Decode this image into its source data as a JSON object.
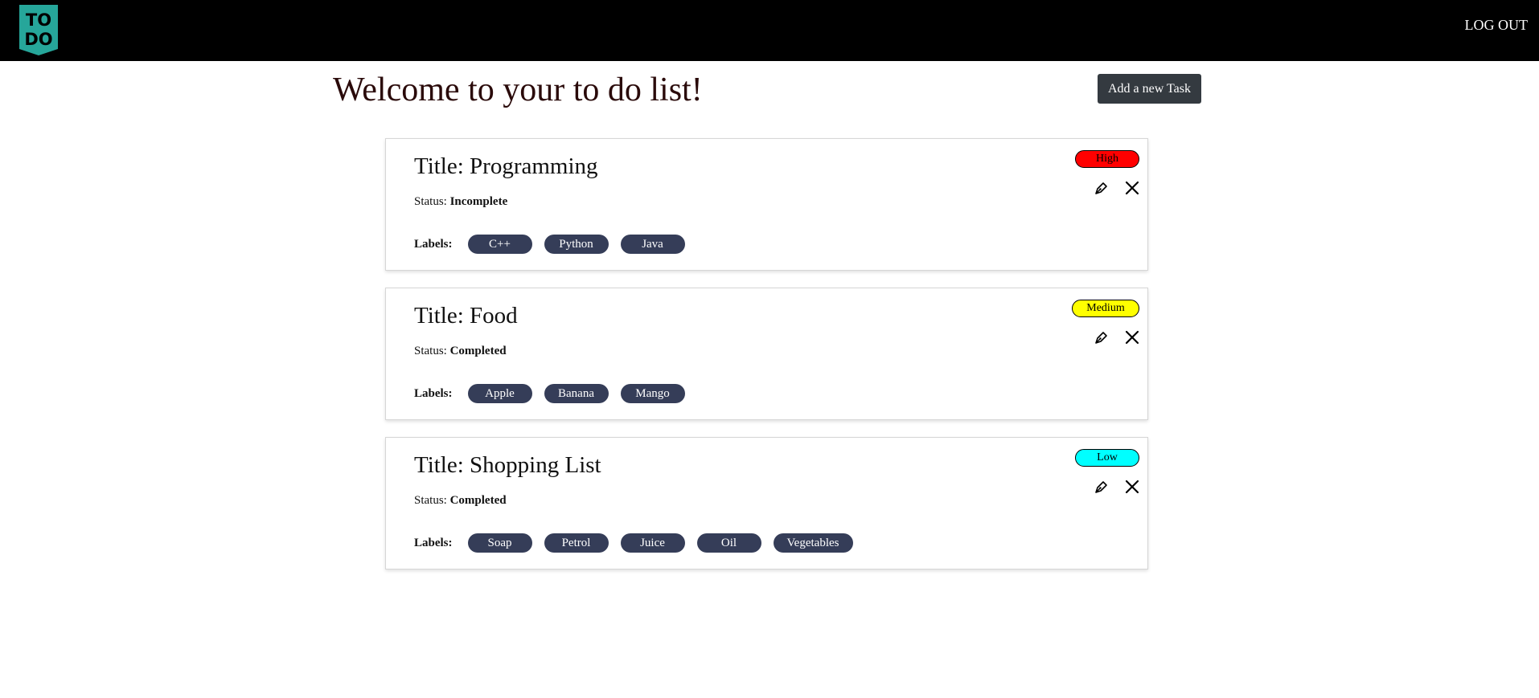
{
  "header": {
    "logo_text_top": "TO",
    "logo_text_bottom": "DO",
    "logo_color": "#26a69a",
    "logout_label": "LOG OUT"
  },
  "main": {
    "welcome_title": "Welcome to your to do list!",
    "add_task_label": "Add a new Task"
  },
  "tasks": [
    {
      "title": "Title: Programming",
      "status_label": "Status:",
      "status_value": "Incomplete",
      "priority": "High",
      "priority_color": "#ff0000",
      "labels_heading": "Labels:",
      "labels": [
        "C++",
        "Python",
        "Java"
      ]
    },
    {
      "title": "Title: Food",
      "status_label": "Status:",
      "status_value": "Completed",
      "priority": "Medium",
      "priority_color": "#ffff00",
      "labels_heading": "Labels:",
      "labels": [
        "Apple",
        "Banana",
        "Mango"
      ]
    },
    {
      "title": "Title: Shopping List",
      "status_label": "Status:",
      "status_value": "Completed",
      "priority": "Low",
      "priority_color": "#00ffff",
      "labels_heading": "Labels:",
      "labels": [
        "Soap",
        "Petrol",
        "Juice",
        "Oil",
        "Vegetables"
      ]
    }
  ],
  "icons": {
    "edit": "pen-icon",
    "delete": "close-icon"
  },
  "colors": {
    "topbar": "#000000",
    "chip": "#353d58",
    "add_button": "#343a40"
  }
}
